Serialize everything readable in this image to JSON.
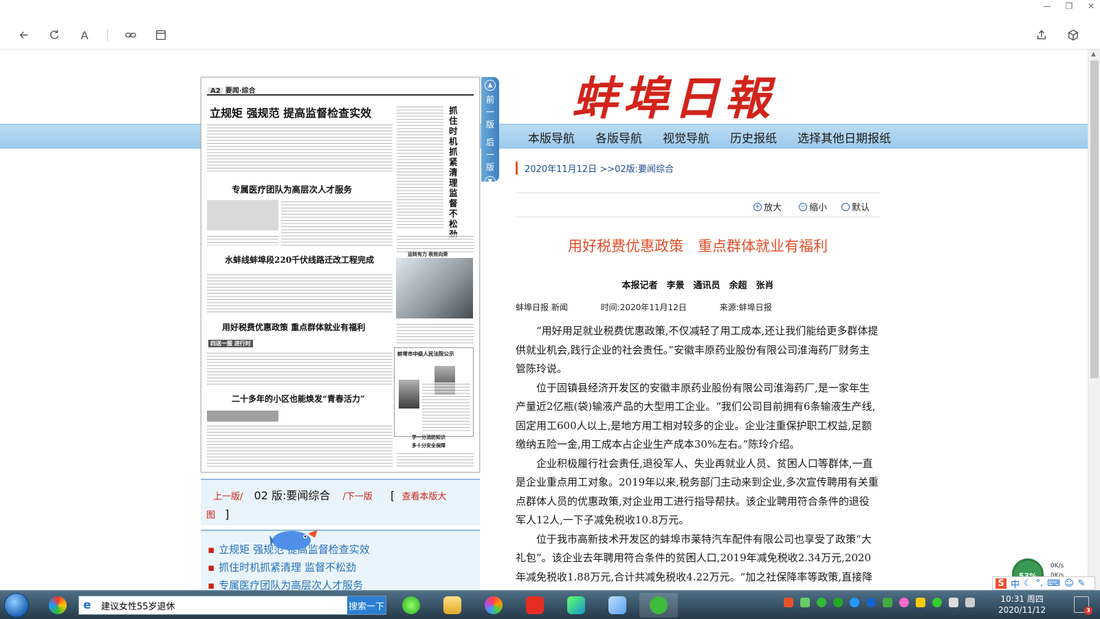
{
  "browser": {
    "window_controls": [
      "—",
      "❐",
      "✕"
    ],
    "toolbar": [
      "back",
      "refresh",
      "font",
      "link",
      "reader"
    ],
    "font_glyph": "A"
  },
  "masthead": "蚌埠日報",
  "nav": [
    "本版导航",
    "各版导航",
    "视觉导航",
    "历史报纸",
    "选择其他日期报纸"
  ],
  "breadcrumb": "2020年11月12日 >>02版:要闻综合",
  "paper": {
    "page_label": "A2",
    "section": "要闻·综合",
    "headlines": [
      "立规矩 强规范 提高监督检查实效",
      "专属医疗团队为高层次人才服务",
      "水蚌线蚌埠段220千伏线路迁改工程完成",
      "用好税费优惠政策 重点群体就业有福利",
      "二十多年的小区也能焕发“青春活力”"
    ],
    "vertical_title": "抓住时机抓紧清理 监督不松劲",
    "court_notice": "蚌埠市中级人民法院公示",
    "small_captions": [
      "运转有力 秩效向荣",
      "学一分消防知识",
      "多十分安全保障"
    ],
    "tag": "四送一服 进行时"
  },
  "side_tab": {
    "prev": "前一版",
    "next": "后一版"
  },
  "pager": {
    "prev": "上一版/",
    "current": "02 版:要闻综合",
    "next": "/下一版",
    "open": "[",
    "view_big": "查看本版大",
    "view_big_2": "图",
    "close": "]"
  },
  "titles": [
    "立规矩 强规范 提高监督检查实效",
    "抓住时机抓紧清理 监督不松劲",
    "专属医疗团队为高层次人才服务"
  ],
  "zoom": {
    "in": "放大",
    "out": "缩小",
    "default": "默认"
  },
  "article": {
    "title": "用好税费优惠政策　重点群体就业有福利",
    "byline": "本报记者　李景　通讯员　余超　张肖",
    "source_name": "蚌埠日报 新闻",
    "time": "时间:2020年11月12日",
    "from": "来源:蚌埠日报",
    "paragraphs": [
      "“用好用足就业税费优惠政策,不仅减轻了用工成本,还让我们能给更多群体提供就业机会,践行企业的社会责任。”安徽丰原药业股份有限公司淮海药厂财务主管陈玲说。",
      "位于固镇县经济开发区的安徽丰原药业股份有限公司淮海药厂,是一家年生产量近2亿瓶(袋)输液产品的大型用工企业。“我们公司目前拥有6条输液生产线,固定用工600人以上,是地方用工相对较多的企业。企业注重保护职工权益,足额缴纳五险一金,用工成本占企业生产成本30%左右。”陈玲介绍。",
      "企业积极履行社会责任,退役军人、失业再就业人员、贫困人口等群体,一直是企业重点用工对象。2019年以来,税务部门主动来到企业,多次宣传聘用有关重点群体人员的优惠政策,对企业用工进行指导帮扶。该企业聘用符合条件的退役军人12人,一下子减免税收10.8万元。",
      "位于我市高新技术开发区的蚌埠市莱特汽车配件有限公司也享受了政策“大礼包”。该企业去年聘用符合条件的贫困人口,2019年减免税收2.34万元,2020年减免税收1.88万元,合计共减免税收4.22万元。“加之社保降率等政策,直接降低了用工成本"
    ]
  },
  "widget": {
    "percent": "53%",
    "up": "0K/s",
    "down": "0K/s"
  },
  "ime": {
    "label": "中"
  },
  "taskbar": {
    "search_value": "建议女性55岁退休",
    "search_button": "搜索一下",
    "time": "10:31 周四",
    "date": "2020/11/12",
    "notif_count": "3"
  },
  "colors": {
    "accent_red": "#d2241b",
    "nav_blue": "#a9d2f0",
    "link_blue": "#2470b8",
    "title_orange": "#e34f2a"
  }
}
